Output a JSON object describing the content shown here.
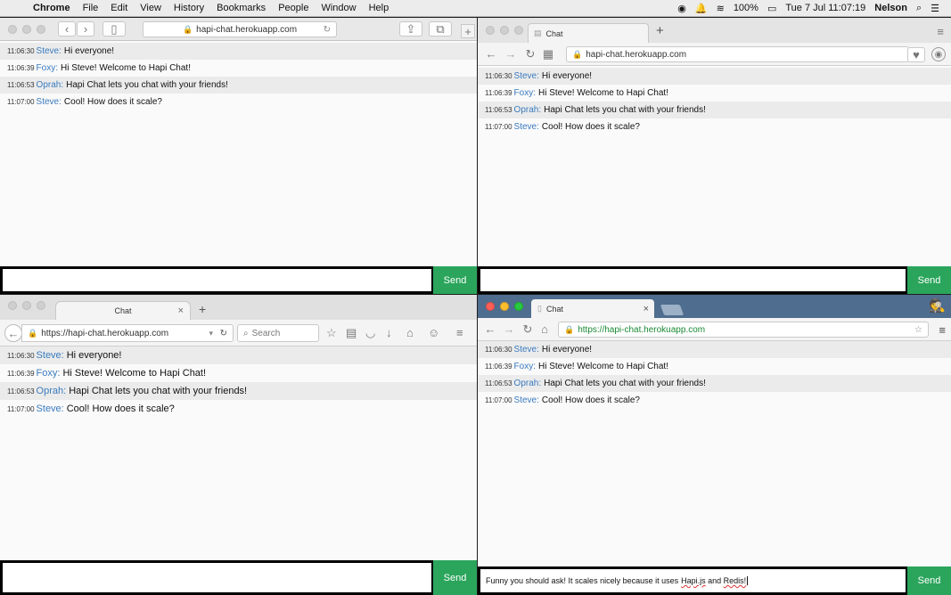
{
  "menubar": {
    "apple": "",
    "items": [
      "Chrome",
      "File",
      "Edit",
      "View",
      "History",
      "Bookmarks",
      "People",
      "Window",
      "Help"
    ],
    "battery": "100%",
    "datetime": "Tue 7 Jul  11:07:19",
    "user": "Nelson"
  },
  "windows": {
    "safari": {
      "url": "hapi-chat.herokuapp.com"
    },
    "chrome": {
      "tab_label": "Chat",
      "url": "hapi-chat.herokuapp.com"
    },
    "firefox": {
      "tab_label": "Chat",
      "url": "https://hapi-chat.herokuapp.com",
      "search_placeholder": "Search"
    },
    "chrome_incognito": {
      "tab_label": "Chat",
      "url": "https://hapi-chat.herokuapp.com"
    }
  },
  "chat": {
    "messages": [
      {
        "time": "11:06:30",
        "name": "Steve:",
        "text": "Hi everyone!"
      },
      {
        "time": "11:06:39",
        "name": "Foxy:",
        "text": "Hi Steve! Welcome to Hapi Chat!"
      },
      {
        "time": "11:06:53",
        "name": "Oprah:",
        "text": "Hapi Chat lets you chat with your friends!"
      },
      {
        "time": "11:07:00",
        "name": "Steve:",
        "text": "Cool! How does it scale?"
      }
    ],
    "send_label": "Send",
    "draft_part1": "Funny you should ask! It scales nicely because it uses ",
    "draft_word1": "Hapi.js",
    "draft_part2": " and ",
    "draft_word2": "Redis!"
  }
}
